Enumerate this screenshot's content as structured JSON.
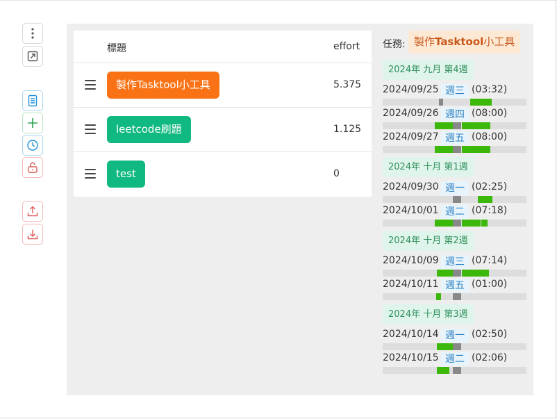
{
  "toolbar": {
    "items": [
      {
        "name": "more-button",
        "icon": "vertical-dots-icon",
        "color": "#555555"
      },
      {
        "name": "open-external-button",
        "icon": "external-link-icon",
        "color": "#555555"
      },
      {
        "name": "document-button",
        "icon": "document-icon",
        "color": "#1e90d6"
      },
      {
        "name": "add-button",
        "icon": "plus-icon",
        "color": "#2aa14d"
      },
      {
        "name": "clock-button",
        "icon": "clock-icon",
        "color": "#1e90d6"
      },
      {
        "name": "unlock-button",
        "icon": "unlock-icon",
        "color": "#e05a5a"
      },
      {
        "name": "upload-button",
        "icon": "upload-icon",
        "color": "#e05a5a"
      },
      {
        "name": "download-button",
        "icon": "download-icon",
        "color": "#e05a5a"
      }
    ]
  },
  "table": {
    "header_title": "標題",
    "header_effort": "effort",
    "rows": [
      {
        "title": "製作Tasktool小工具",
        "effort": "5.375",
        "color": "#f97316"
      },
      {
        "title": "leetcode刷題",
        "effort": "1.125",
        "color": "#10b981"
      },
      {
        "title": "test",
        "effort": "0",
        "color": "#10b981"
      }
    ]
  },
  "side": {
    "task_label": "任務:",
    "task_prefix": "製作",
    "task_bold": "Tasktool",
    "task_suffix": "小工具",
    "weeks": [
      {
        "label": "2024年 九月 第4週",
        "days": [
          {
            "date": "2024/09/25",
            "weekday": "週三",
            "duration": "(03:32)",
            "segments": [
              [
                0.39,
                0.42,
                "#888888"
              ],
              [
                0.61,
                0.76,
                "#3cb80b"
              ]
            ]
          },
          {
            "date": "2024/09/26",
            "weekday": "週四",
            "duration": "(08:00)",
            "segments": [
              [
                0.36,
                0.49,
                "#3cb80b"
              ],
              [
                0.49,
                0.55,
                "#888888"
              ],
              [
                0.55,
                0.75,
                "#3cb80b"
              ]
            ]
          },
          {
            "date": "2024/09/27",
            "weekday": "週五",
            "duration": "(08:00)",
            "segments": [
              [
                0.36,
                0.49,
                "#3cb80b"
              ],
              [
                0.49,
                0.55,
                "#888888"
              ],
              [
                0.55,
                0.75,
                "#3cb80b"
              ]
            ]
          }
        ]
      },
      {
        "label": "2024年 十月 第1週",
        "days": [
          {
            "date": "2024/09/30",
            "weekday": "週一",
            "duration": "(02:25)",
            "segments": [
              [
                0.49,
                0.55,
                "#888888"
              ],
              [
                0.66,
                0.76,
                "#3cb80b"
              ]
            ]
          },
          {
            "date": "2024/10/01",
            "weekday": "週二",
            "duration": "(07:18)",
            "segments": [
              [
                0.36,
                0.49,
                "#3cb80b"
              ],
              [
                0.49,
                0.55,
                "#888888"
              ],
              [
                0.55,
                0.68,
                "#3cb80b"
              ],
              [
                0.685,
                0.73,
                "#3cb80b"
              ]
            ]
          }
        ]
      },
      {
        "label": "2024年 十月 第2週",
        "days": [
          {
            "date": "2024/10/09",
            "weekday": "週三",
            "duration": "(07:14)",
            "segments": [
              [
                0.375,
                0.49,
                "#3cb80b"
              ],
              [
                0.49,
                0.55,
                "#888888"
              ],
              [
                0.55,
                0.74,
                "#3cb80b"
              ]
            ]
          },
          {
            "date": "2024/10/11",
            "weekday": "週五",
            "duration": "(01:00)",
            "segments": [
              [
                0.37,
                0.405,
                "#3cb80b"
              ],
              [
                0.49,
                0.55,
                "#888888"
              ]
            ]
          }
        ]
      },
      {
        "label": "2024年 十月 第3週",
        "days": [
          {
            "date": "2024/10/14",
            "weekday": "週一",
            "duration": "(02:50)",
            "segments": [
              [
                0.375,
                0.49,
                "#3cb80b"
              ],
              [
                0.49,
                0.55,
                "#888888"
              ]
            ]
          },
          {
            "date": "2024/10/15",
            "weekday": "週二",
            "duration": "(02:06)",
            "segments": [
              [
                0.375,
                0.46,
                "#3cb80b"
              ],
              [
                0.49,
                0.55,
                "#888888"
              ]
            ]
          }
        ]
      }
    ]
  }
}
